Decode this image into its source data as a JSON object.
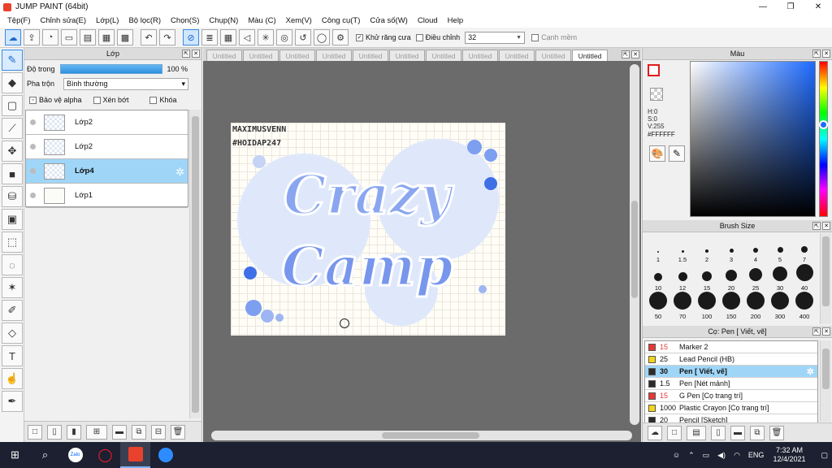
{
  "window": {
    "title": "JUMP PAINT (64bit)",
    "min": "—",
    "max": "❐",
    "close": "✕"
  },
  "menu": [
    "Tệp(F)",
    "Chỉnh sửa(E)",
    "Lớp(L)",
    "Bộ lọc(R)",
    "Chọn(S)",
    "Chụp(N)",
    "Màu (C)",
    "Xem(V)",
    "Công cụ(T)",
    "Cửa số(W)",
    "Cloud",
    "Help"
  ],
  "toolbar": {
    "antialias_label": "Khử răng cưa",
    "adjust_label": "Điều chỉnh",
    "adjust_value": "32",
    "smooth_label": "Cạnh mềm"
  },
  "layer_panel": {
    "title": "Lớp",
    "opacity_label": "Độ trong",
    "opacity_value": "100 %",
    "opacity_fraction": 1.0,
    "blend_label": "Pha trộn",
    "blend_value": "Bình thường",
    "protect_alpha": "Bảo vệ alpha",
    "clipping": "Xén bớt",
    "lock": "Khóa",
    "layers": [
      {
        "name": "Lớp2",
        "selected": false
      },
      {
        "name": "Lớp2",
        "selected": false
      },
      {
        "name": "Lớp4",
        "selected": true
      },
      {
        "name": "Lớp1",
        "selected": false
      }
    ]
  },
  "tabs": [
    "Untitled",
    "Untitled",
    "Untitled",
    "Untitled",
    "Untitled",
    "Untitled",
    "Untitled",
    "Untitled",
    "Untitled",
    "Untitled",
    "Untitled"
  ],
  "active_tab_index": 10,
  "canvas": {
    "watermark_line1": "MAXIMUSVENN",
    "watermark_line2": "#HOIDAP247",
    "art_word1": "Crazy",
    "art_word2": "Camp"
  },
  "color_panel": {
    "title": "Màu",
    "h": "H:0",
    "s": "S:0",
    "v": "V:255",
    "hex": "#FFFFFF",
    "fg_color": "#ffffff",
    "accent": "#e21b1b"
  },
  "brush_panel": {
    "title": "Brush Size",
    "sizes": [
      "1",
      "1.5",
      "2",
      "3",
      "4",
      "5",
      "7",
      "10",
      "12",
      "15",
      "20",
      "25",
      "30",
      "40",
      "50",
      "70",
      "100",
      "150",
      "200",
      "300",
      "400"
    ]
  },
  "pen_panel": {
    "title": "Cọ: Pen [ Viết, vẽ]",
    "pens": [
      {
        "size": "15",
        "name": "Marker 2",
        "color": "#e53935",
        "active": false
      },
      {
        "size": "25",
        "name": "Lead Pencil (HB)",
        "color": "#f2d51a",
        "active": false
      },
      {
        "size": "30",
        "name": "Pen [ Viết, vẽ]",
        "color": "#2b2b2b",
        "active": true
      },
      {
        "size": "1.5",
        "name": "Pen [Nét mảnh]",
        "color": "#2b2b2b",
        "active": false
      },
      {
        "size": "15",
        "name": "G Pen [Cọ trang trí]",
        "color": "#e53935",
        "active": false
      },
      {
        "size": "1000",
        "name": "Plastic Crayon [Cọ trang trí]",
        "color": "#f2d51a",
        "active": false
      },
      {
        "size": "20",
        "name": "Pencil [Sketch]",
        "color": "#2b2b2b",
        "active": false
      }
    ]
  },
  "taskbar": {
    "apps": [
      "Zalo",
      "Opera",
      "Jump Paint",
      "Zoom"
    ],
    "lang": "ENG",
    "time": "7:32 AM",
    "date": "12/4/2021"
  }
}
